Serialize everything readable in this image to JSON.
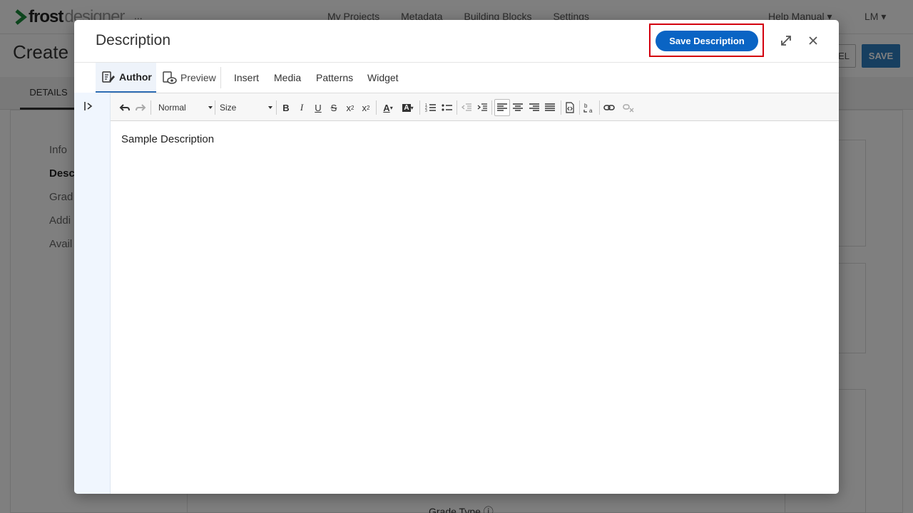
{
  "app": {
    "logo_main": "frost",
    "logo_sub": "designer",
    "logo_extra": "...",
    "nav": [
      "My Projects",
      "Metadata",
      "Building Blocks",
      "Settings"
    ],
    "help_label": "Help Manual",
    "user_initials": "LM"
  },
  "page": {
    "title": "Create N",
    "cancel_label": "EL",
    "save_label": "SAVE",
    "details_tab": "DETAILS",
    "side_items": [
      "Info",
      "Desc",
      "Grad",
      "Addi",
      "Avail"
    ],
    "grade_type_label": "Grade Type"
  },
  "modal": {
    "title": "Description",
    "save_button": "Save Description",
    "tabs": {
      "author": "Author",
      "preview": "Preview",
      "insert": "Insert",
      "media": "Media",
      "patterns": "Patterns",
      "widget": "Widget"
    },
    "toolbar": {
      "format_value": "Normal",
      "size_placeholder": "Size"
    },
    "content": "Sample Description"
  },
  "colors": {
    "primary": "#0a64c4",
    "highlight_frame": "#d3000e",
    "save_bg": "#2f7fc1"
  }
}
